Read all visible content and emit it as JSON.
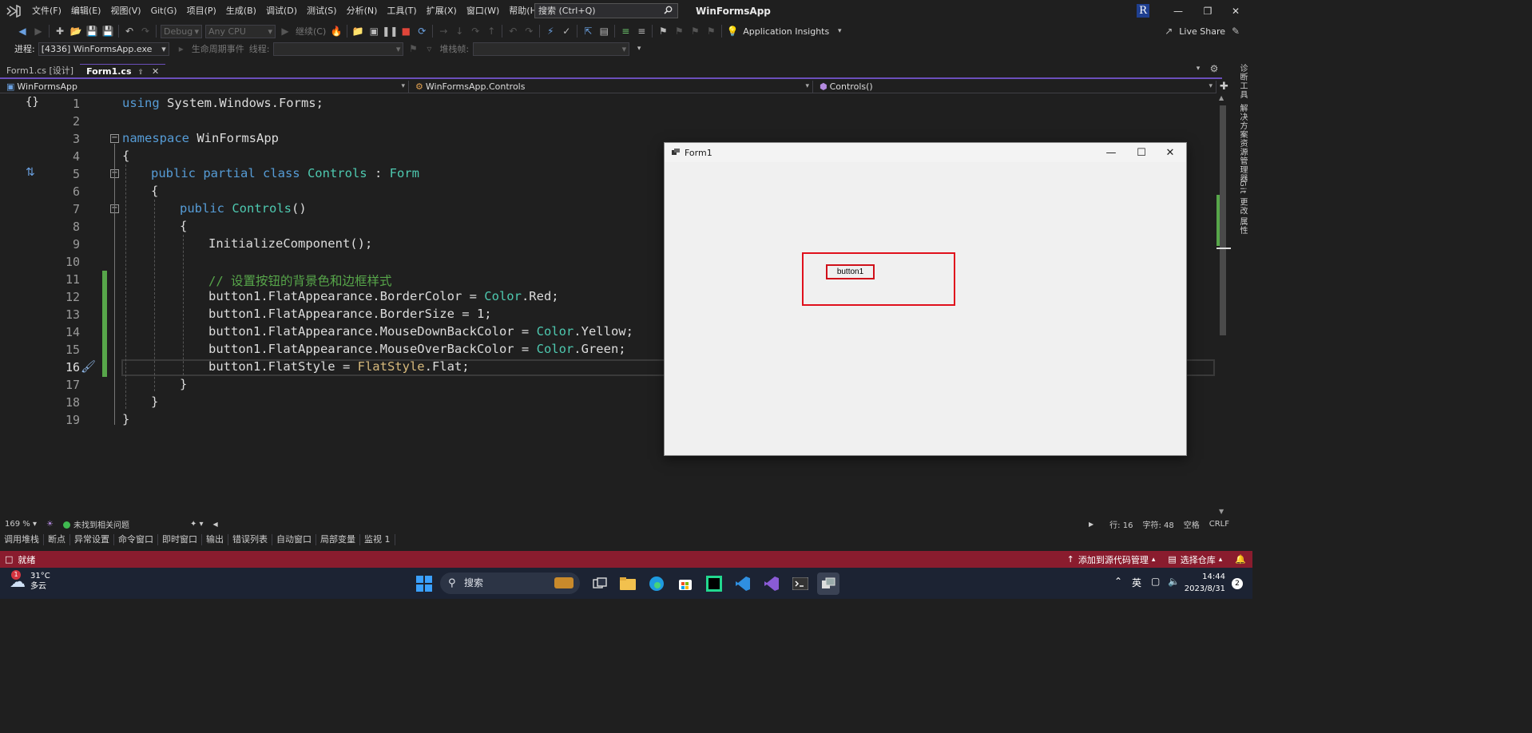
{
  "titlebar": {
    "menu": [
      "文件(F)",
      "编辑(E)",
      "视图(V)",
      "Git(G)",
      "项目(P)",
      "生成(B)",
      "调试(D)",
      "测试(S)",
      "分析(N)",
      "工具(T)",
      "扩展(X)",
      "窗口(W)",
      "帮助(H)"
    ],
    "search_placeholder": "搜索 (Ctrl+Q)",
    "app_title": "WinFormsApp",
    "avatar_letter": "R"
  },
  "toolbar": {
    "config": "Debug",
    "platform": "Any CPU",
    "continue_label": "继续(C)",
    "app_insights": "Application Insights",
    "live_share": "Live Share"
  },
  "debugbar": {
    "process_label": "进程:",
    "process_value": "[4336] WinFormsApp.exe",
    "lifecycle_label": "生命周期事件",
    "thread_label": "线程:",
    "stackframe_label": "堆栈帧:"
  },
  "tabs": [
    {
      "label": "Form1.cs [设计]",
      "active": false
    },
    {
      "label": "Form1.cs",
      "active": true
    }
  ],
  "navbar": {
    "project": "WinFormsApp",
    "type": "WinFormsApp.Controls",
    "member": "Controls()"
  },
  "code": {
    "lines": [
      {
        "n": "1"
      },
      {
        "n": "2"
      },
      {
        "n": "3"
      },
      {
        "n": "4"
      },
      {
        "n": "5"
      },
      {
        "n": "6"
      },
      {
        "n": "7"
      },
      {
        "n": "8"
      },
      {
        "n": "9"
      },
      {
        "n": "10"
      },
      {
        "n": "11"
      },
      {
        "n": "12"
      },
      {
        "n": "13"
      },
      {
        "n": "14"
      },
      {
        "n": "15"
      },
      {
        "n": "16"
      },
      {
        "n": "17"
      },
      {
        "n": "18"
      },
      {
        "n": "19"
      }
    ],
    "current_line": 16,
    "tokens": {
      "l1_kw": "using",
      "l1_rest": " System.Windows.Forms;",
      "l3_kw": "namespace",
      "l3_rest": " WinFormsApp",
      "l4": "{",
      "l5_kw": "public partial class",
      "l5_name": " Controls",
      "l5_colon": " : ",
      "l5_base": "Form",
      "l6": "{",
      "l7_kw": "public",
      "l7_name": " Controls",
      "l7_rest": "()",
      "l8": "{",
      "l9": "InitializeComponent();",
      "l11": "// 设置按钮的背景色和边框样式",
      "l12_a": "button1.FlatAppearance.BorderColor = ",
      "l12_t": "Color",
      "l12_b": ".Red;",
      "l13": "button1.FlatAppearance.BorderSize = 1;",
      "l14_a": "button1.FlatAppearance.MouseDownBackColor = ",
      "l14_t": "Color",
      "l14_b": ".Yellow;",
      "l15_a": "button1.FlatAppearance.MouseOverBackColor = ",
      "l15_t": "Color",
      "l15_b": ".Green;",
      "l16_a": "button1.FlatStyle = ",
      "l16_t": "FlatStyle",
      "l16_b": ".Flat;",
      "l17": "}",
      "l18": "}",
      "l19": "}"
    }
  },
  "form1": {
    "title": "Form1",
    "button_label": "button1"
  },
  "right_rail": [
    "诊断工具",
    "解决方案资源管理器",
    "Git 更改",
    "属性"
  ],
  "editor_status": {
    "zoom": "169 %",
    "issues": "未找到相关问题",
    "line": "行: 16",
    "col": "字符: 48",
    "spaces": "空格",
    "eol": "CRLF"
  },
  "tool_tabs": [
    "调用堆栈",
    "断点",
    "异常设置",
    "命令窗口",
    "即时窗口",
    "输出",
    "错误列表",
    "自动窗口",
    "局部变量",
    "监视 1"
  ],
  "statusbar": {
    "ready": "就绪",
    "source_control": "添加到源代码管理",
    "repo": "选择仓库"
  },
  "taskbar": {
    "temp": "31°C",
    "weather": "多云",
    "weather_badge": "1",
    "search": "搜索",
    "ime": "英",
    "time": "14:44",
    "date": "2023/8/31",
    "notif": "2"
  },
  "colors": {
    "accent": "#6b4fbb",
    "status_bar": "#8a1c2e",
    "keyword": "#569cd6",
    "type": "#4ec9b0",
    "comment": "#57a64a",
    "button_border": "#e0101c"
  }
}
